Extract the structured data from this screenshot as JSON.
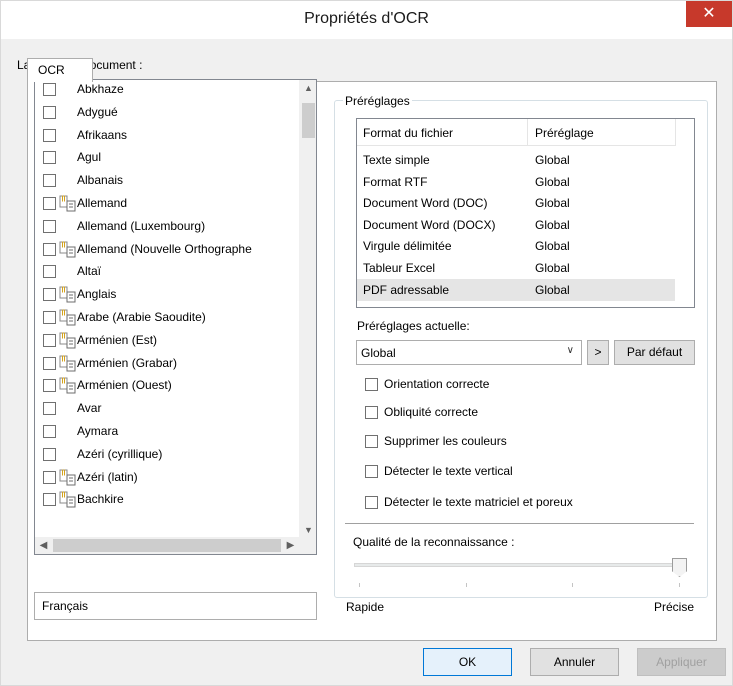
{
  "window": {
    "title": "Propriétés d'OCR",
    "close_glyph": "✕"
  },
  "tabs": [
    {
      "label": "OCR"
    }
  ],
  "languages": {
    "label": "Langues du document :",
    "items": [
      {
        "label": "Abkhaze",
        "dict": false
      },
      {
        "label": "Adygué",
        "dict": false
      },
      {
        "label": "Afrikaans",
        "dict": false
      },
      {
        "label": "Agul",
        "dict": false
      },
      {
        "label": "Albanais",
        "dict": false
      },
      {
        "label": "Allemand",
        "dict": true
      },
      {
        "label": "Allemand (Luxembourg)",
        "dict": false
      },
      {
        "label": "Allemand (Nouvelle Orthographe",
        "dict": true
      },
      {
        "label": "Altaï",
        "dict": false
      },
      {
        "label": "Anglais",
        "dict": true
      },
      {
        "label": "Arabe (Arabie Saoudite)",
        "dict": true
      },
      {
        "label": "Arménien (Est)",
        "dict": true
      },
      {
        "label": "Arménien (Grabar)",
        "dict": true
      },
      {
        "label": "Arménien (Ouest)",
        "dict": true
      },
      {
        "label": "Avar",
        "dict": false
      },
      {
        "label": "Aymara",
        "dict": false
      },
      {
        "label": "Azéri (cyrillique)",
        "dict": false
      },
      {
        "label": "Azéri (latin)",
        "dict": true
      },
      {
        "label": "Bachkire",
        "dict": true
      }
    ],
    "selected_display": "Français"
  },
  "presets": {
    "group_label": "Préréglages",
    "columns": [
      "Format du fichier",
      "Préréglage"
    ],
    "rows": [
      {
        "format": "Texte simple",
        "preset": "Global"
      },
      {
        "format": "Format RTF",
        "preset": "Global"
      },
      {
        "format": "Document Word (DOC)",
        "preset": "Global"
      },
      {
        "format": "Document Word (DOCX)",
        "preset": "Global"
      },
      {
        "format": "Virgule délimitée",
        "preset": "Global"
      },
      {
        "format": "Tableur Excel",
        "preset": "Global"
      },
      {
        "format": "PDF adressable",
        "preset": "Global",
        "selected": true
      }
    ],
    "current_label": "Préréglages actuelle:",
    "current_value": "Global",
    "next_label": ">",
    "default_label": "Par défaut"
  },
  "options": [
    {
      "label": "Orientation correcte",
      "checked": false
    },
    {
      "label": "Obliquité correcte",
      "checked": false
    },
    {
      "label": "Supprimer les couleurs",
      "checked": false
    },
    {
      "label": "Détecter le texte vertical",
      "checked": false
    },
    {
      "label": "Détecter le texte matriciel et poreux",
      "checked": false
    }
  ],
  "quality": {
    "label": "Qualité de la reconnaissance :",
    "min_label": "Rapide",
    "max_label": "Précise",
    "level": 1.0
  },
  "buttons": {
    "ok": "OK",
    "cancel": "Annuler",
    "apply": "Appliquer"
  },
  "colors": {
    "close": "#c7392b",
    "ok_border": "#0078d7",
    "selection": "#e5e5e5"
  }
}
